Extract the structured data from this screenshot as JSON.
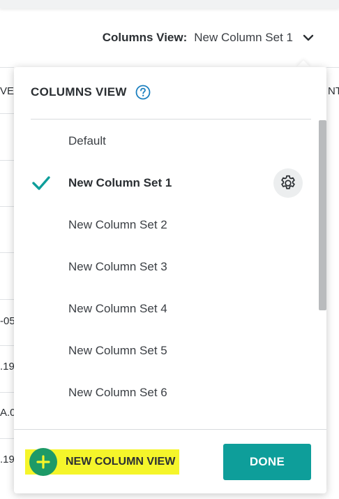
{
  "header": {
    "columns_view_label": "Columns View:",
    "columns_view_value": "New Column Set 1"
  },
  "background_table": {
    "left_fragments": [
      "VEI",
      "-05",
      ".19",
      "A.0",
      ".19"
    ],
    "right_fragments": [
      "NT"
    ]
  },
  "panel": {
    "title": "COLUMNS VIEW",
    "help_icon": "question-circle-icon",
    "items": [
      {
        "label": "Default",
        "selected": false
      },
      {
        "label": "New Column Set 1",
        "selected": true
      },
      {
        "label": "New Column Set 2",
        "selected": false
      },
      {
        "label": "New Column Set 3",
        "selected": false
      },
      {
        "label": "New Column Set 4",
        "selected": false
      },
      {
        "label": "New Column Set 5",
        "selected": false
      },
      {
        "label": "New Column Set 6",
        "selected": false
      }
    ],
    "new_view_label": "NEW COLUMN VIEW",
    "done_label": "DONE"
  },
  "colors": {
    "accent_teal": "#0e9e9a",
    "plus_green": "#1d9a67",
    "highlight_yellow": "#f5f52a"
  }
}
